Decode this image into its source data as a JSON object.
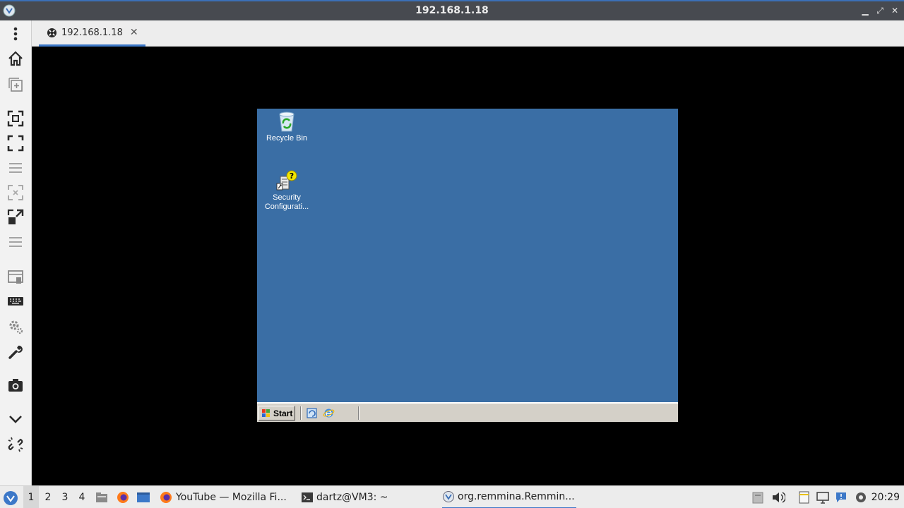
{
  "window": {
    "title": "192.168.1.18"
  },
  "tab": {
    "label": "192.168.1.18",
    "close": "✕"
  },
  "toolbar": {
    "icons": [
      "menu-icon",
      "home-icon",
      "new-connection-icon",
      "fit-window-icon",
      "fullscreen-icon",
      "separator-lines-icon",
      "dynamic-resolution-icon",
      "scale-icon",
      "separator-lines-icon",
      "multi-monitor-icon",
      "keyboard-icon",
      "preferences-icon",
      "tools-icon",
      "screenshot-icon",
      "minimize-toolbar-icon",
      "disconnect-icon"
    ]
  },
  "remote": {
    "desktop_icons": [
      {
        "label": "Recycle Bin"
      },
      {
        "label_line1": "Security",
        "label_line2": "Configurati..."
      }
    ],
    "taskbar": {
      "start_label": "Start"
    },
    "colors": {
      "desktop": "#3a6ea5",
      "taskbar": "#d4d0c8"
    }
  },
  "panel": {
    "workspaces": [
      "1",
      "2",
      "3",
      "4"
    ],
    "tasks": [
      {
        "label": "YouTube — Mozilla Fi..."
      },
      {
        "label": "dartz@VM3: ~"
      },
      {
        "label": "org.remmina.Remmin..."
      }
    ],
    "clock": "20:29"
  }
}
